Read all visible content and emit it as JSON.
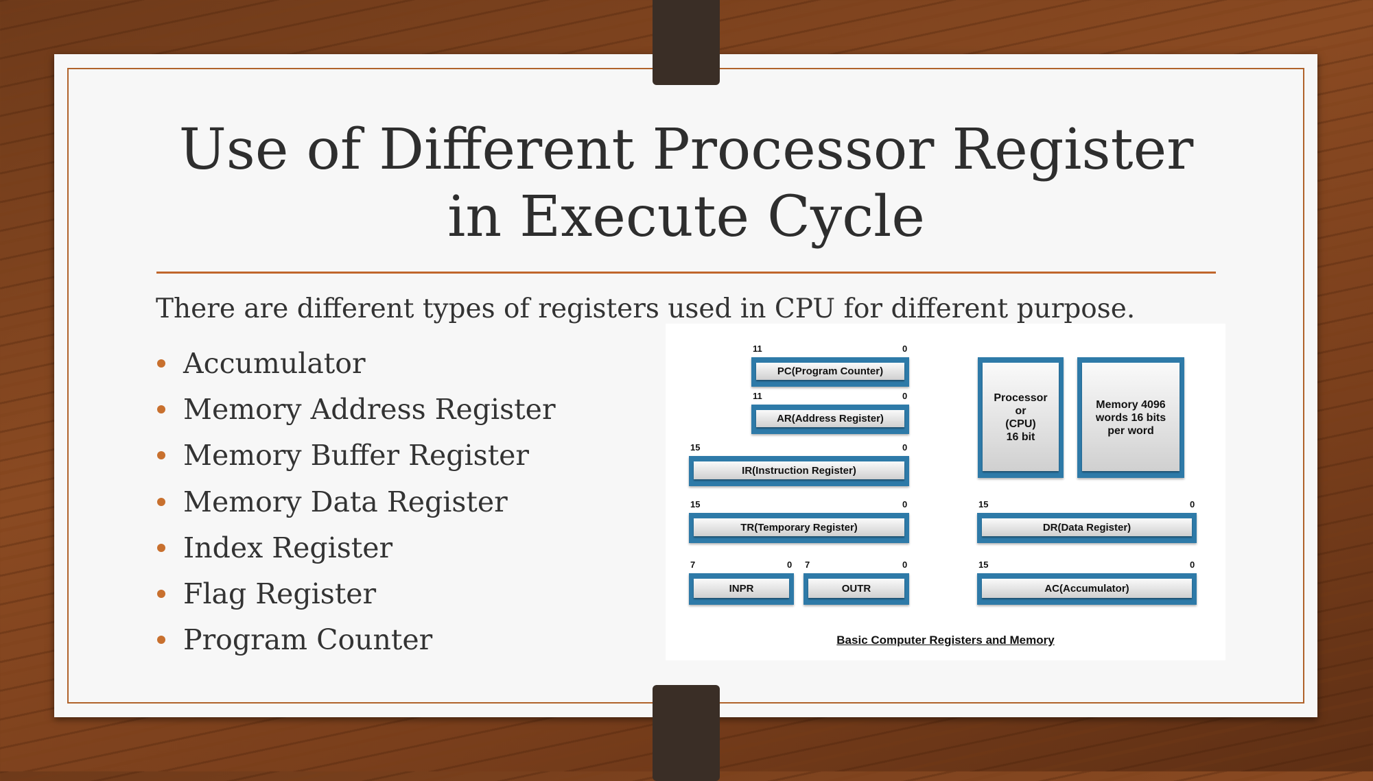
{
  "slide": {
    "title_line1": "Use of Different Processor Register",
    "title_line2": "in Execute Cycle",
    "intro": "There are different types of registers used in CPU for different purpose.",
    "bullets": [
      "Accumulator",
      "Memory Address Register",
      "Memory Buffer Register",
      "Memory Data Register",
      "Index Register",
      "Flag Register",
      "Program Counter"
    ],
    "accent_color": "#c0662c"
  },
  "diagram": {
    "caption": "Basic Computer Registers and Memory",
    "box_color": "#2e7aa8",
    "registers": {
      "pc": {
        "label": "PC(Program Counter)",
        "hi": "11",
        "lo": "0"
      },
      "ar": {
        "label": "AR(Address Register)",
        "hi": "11",
        "lo": "0"
      },
      "ir": {
        "label": "IR(Instruction Register)",
        "hi": "15",
        "lo": "0"
      },
      "tr": {
        "label": "TR(Temporary Register)",
        "hi": "15",
        "lo": "0"
      },
      "inpr": {
        "label": "INPR",
        "hi": "7",
        "lo": "0"
      },
      "outr": {
        "label": "OUTR",
        "hi": "7",
        "lo": "0"
      },
      "dr": {
        "label": "DR(Data Register)",
        "hi": "15",
        "lo": "0"
      },
      "ac": {
        "label": "AC(Accumulator)",
        "hi": "15",
        "lo": "0"
      }
    },
    "processor": [
      "Processor",
      "or",
      "(CPU)",
      "16 bit"
    ],
    "memory": [
      "Memory 4096",
      "words 16 bits",
      "per word"
    ]
  }
}
